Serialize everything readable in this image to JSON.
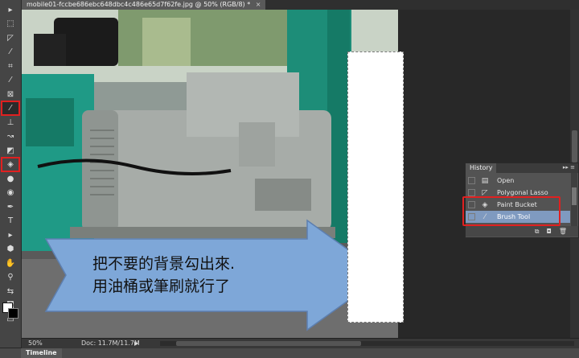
{
  "document": {
    "tab_title": "mobile01-fccbe686ebc648dbc4c486e65d7f62fe.jpg @ 50% (RGB/8) *",
    "close_glyph": "×"
  },
  "tools": [
    {
      "name": "move",
      "icon": "move-icon",
      "glyph": "▸",
      "highlighted": false
    },
    {
      "name": "marquee",
      "icon": "marquee-icon",
      "glyph": "⬚",
      "highlighted": false
    },
    {
      "name": "polygonal-lasso",
      "icon": "lasso-icon",
      "glyph": "◸",
      "highlighted": false
    },
    {
      "name": "quick-selection",
      "icon": "wand-icon",
      "glyph": "⁄",
      "highlighted": false
    },
    {
      "name": "crop",
      "icon": "crop-icon",
      "glyph": "⌗",
      "highlighted": false
    },
    {
      "name": "eyedropper",
      "icon": "eyedropper-icon",
      "glyph": "⁄",
      "highlighted": false
    },
    {
      "name": "healing",
      "icon": "bandage-icon",
      "glyph": "⊠",
      "highlighted": false
    },
    {
      "name": "brush",
      "icon": "brush-icon",
      "glyph": "⁄",
      "highlighted": true
    },
    {
      "name": "stamp",
      "icon": "stamp-icon",
      "glyph": "⊥",
      "highlighted": false
    },
    {
      "name": "history-brush",
      "icon": "history-brush-icon",
      "glyph": "↝",
      "highlighted": false
    },
    {
      "name": "eraser",
      "icon": "eraser-icon",
      "glyph": "◩",
      "highlighted": false
    },
    {
      "name": "paint-bucket",
      "icon": "paint-bucket-icon",
      "glyph": "◈",
      "highlighted": true
    },
    {
      "name": "dodge",
      "icon": "dodge-icon",
      "glyph": "●",
      "highlighted": false
    },
    {
      "name": "blur",
      "icon": "blur-icon",
      "glyph": "◉",
      "highlighted": false
    },
    {
      "name": "pen",
      "icon": "pen-icon",
      "glyph": "✒",
      "highlighted": false
    },
    {
      "name": "type",
      "icon": "type-icon",
      "glyph": "T",
      "highlighted": false
    },
    {
      "name": "path-selection",
      "icon": "path-selection-icon",
      "glyph": "▸",
      "highlighted": false
    },
    {
      "name": "shape",
      "icon": "shape-icon",
      "glyph": "⬢",
      "highlighted": false
    },
    {
      "name": "hand",
      "icon": "hand-icon",
      "glyph": "✋",
      "highlighted": false
    },
    {
      "name": "zoom",
      "icon": "zoom-icon",
      "glyph": "⚲",
      "highlighted": false
    },
    {
      "name": "swap-colors",
      "icon": "swap-icon",
      "glyph": "⇆",
      "highlighted": false
    },
    {
      "name": "quick-mask",
      "icon": "quick-mask-icon",
      "glyph": "◙",
      "highlighted": false
    },
    {
      "name": "screen-mode",
      "icon": "screen-mode-icon",
      "glyph": "▭",
      "highlighted": false
    }
  ],
  "callout": {
    "line1": "把不要的背景勾出來.",
    "line2": "用油桶或筆刷就行了",
    "fill": "#7ea7d8",
    "text_color": "#111111"
  },
  "status": {
    "zoom": "50%",
    "doc": "Doc: 11.7M/11.7M",
    "arrow": "▶"
  },
  "timeline": {
    "label": "Timeline"
  },
  "history": {
    "title": "History",
    "menu_glyph": "▸▸ ≡",
    "items": [
      {
        "label": "Open",
        "icon": "open-document-icon",
        "glyph": "▤",
        "selected": false
      },
      {
        "label": "Polygonal Lasso",
        "icon": "lasso-icon",
        "glyph": "◸",
        "selected": false
      },
      {
        "label": "Paint Bucket",
        "icon": "paint-bucket-icon",
        "glyph": "◈",
        "selected": false
      },
      {
        "label": "Brush Tool",
        "icon": "brush-icon",
        "glyph": "⁄",
        "selected": true
      }
    ],
    "footer": [
      {
        "icon": "new-document-from-state-icon",
        "glyph": "⧉"
      },
      {
        "icon": "snapshot-camera-icon",
        "glyph": "◘"
      },
      {
        "icon": "trash-icon",
        "glyph": "🗑"
      }
    ]
  },
  "colors": {
    "accent_red": "#e02020",
    "history_selection": "#7f9ac0",
    "generator_teal": "#1f9a86"
  }
}
